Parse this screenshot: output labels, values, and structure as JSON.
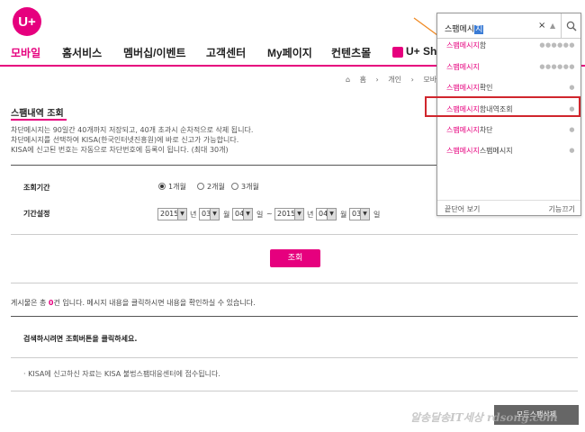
{
  "logo": {
    "text": "U+"
  },
  "gnb": {
    "items": [
      "모바일",
      "홈서비스",
      "멤버십/이벤트",
      "고객센터",
      "My페이지",
      "컨텐츠몰",
      "U+ Sho"
    ],
    "active_index": 0
  },
  "breadcrumb": [
    "홈",
    "개인",
    "모바일"
  ],
  "page": {
    "title": "스팸내역 조회",
    "desc": [
      "차단메시지는 90일간 40개까지 저장되고, 40개 초과시 순차적으로 삭제 됩니다.",
      "차단메시지를 선택하여 KISA(한국인터넷진흥원)에 바로 신고가 가능합니다.",
      "KISA에 신고된 번호는 자동으로 차단번호에 등록이 됩니다. (최대 30개)"
    ]
  },
  "form": {
    "period_label": "조회기간",
    "period_options": [
      "1개월",
      "2개월",
      "3개월"
    ],
    "period_selected": 0,
    "range_label": "기간설정",
    "from": {
      "year": "2015",
      "month": "03",
      "day": "04"
    },
    "to": {
      "year": "2015",
      "month": "04",
      "day": "03"
    },
    "units": {
      "year": "년",
      "month": "월",
      "day": "일"
    },
    "tilde": "~",
    "search_button": "조회"
  },
  "result": {
    "prefix": "게시물은 총 ",
    "count": "0",
    "suffix": "건 입니다. 메시지 내용을 클릭하시면 내용을 확인하실 수 있습니다."
  },
  "notice": "검색하시려면 조회버튼을 클릭하세요.",
  "footer_note": "·  KISA에 신고하신 자료는 KISA 불법스팸대응센터에 접수됩니다.",
  "all_spam_button": "모든스팸삭제",
  "watermark": "알송달송IT세상 rdsong.com",
  "autocomplete": {
    "input_value_main": "스팸메시",
    "input_value_composing": "지",
    "clear": "×",
    "items": [
      {
        "hl": "스팸메시지",
        "rest": "함"
      },
      {
        "hl": "스팸메시지",
        "rest": ""
      },
      {
        "hl": "스팸메시지",
        "rest": "확인"
      },
      {
        "hl": "스팸메시지",
        "rest": "함내역조회"
      },
      {
        "hl": "스팸메시지",
        "rest": "차단"
      },
      {
        "hl": "스팸메시지",
        "rest": "스팸메시지"
      }
    ],
    "highlighted_index": 3,
    "footer_left": "끝단어 보기",
    "footer_right": "기능끄기"
  },
  "colors": {
    "brand": "#e6007e",
    "highlight_box": "#d0262d",
    "arrow": "#f08a24"
  },
  "icons": [
    "search-icon",
    "close-icon",
    "chevron-up-icon",
    "home-icon",
    "shopping-bag-icon"
  ]
}
